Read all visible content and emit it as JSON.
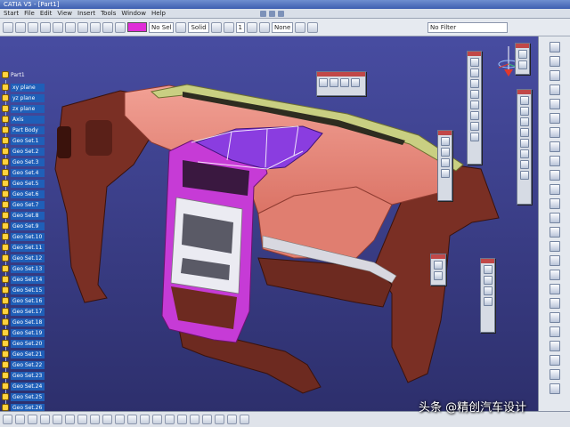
{
  "window": {
    "title": "CATIA V5 - [Part1]"
  },
  "menu": {
    "items": [
      "Start",
      "File",
      "Edit",
      "View",
      "Insert",
      "Tools",
      "Window",
      "Help"
    ]
  },
  "toolbar": {
    "combo_1": "No Sel",
    "combo_2": "Solid",
    "combo_3": "1",
    "combo_4": "None",
    "layer_label": "No Filter",
    "color_value": "#e02cd8"
  },
  "tree": {
    "root_label": "Part1",
    "items": [
      "xy plane",
      "yz plane",
      "zx plane",
      "Axis",
      "Part Body",
      "Geo Set.1",
      "Geo Set.2",
      "Geo Set.3",
      "Geo Set.4",
      "Geo Set.5",
      "Geo Set.6",
      "Geo Set.7",
      "Geo Set.8",
      "Geo Set.9",
      "Geo Set.10",
      "Geo Set.11",
      "Geo Set.12",
      "Geo Set.13",
      "Geo Set.14",
      "Geo Set.15",
      "Geo Set.16",
      "Geo Set.17",
      "Geo Set.18",
      "Geo Set.19",
      "Geo Set.20",
      "Geo Set.21",
      "Geo Set.22",
      "Geo Set.23",
      "Geo Set.24",
      "Geo Set.25",
      "Geo Set.26"
    ]
  },
  "watermark": {
    "text": "头条 @精创汽车设计"
  },
  "colors": {
    "background": "#3b3d8c",
    "dashboard_main": "#e8877a",
    "dashboard_frame": "#7a2f24",
    "bezel": "#c63bd6",
    "top_pad": "#8a3de0",
    "trim": "#c9cf82"
  },
  "icons": {
    "compass": "compass-icon",
    "tree_node": "geometric-set-icon",
    "palette": "tool-icon"
  }
}
